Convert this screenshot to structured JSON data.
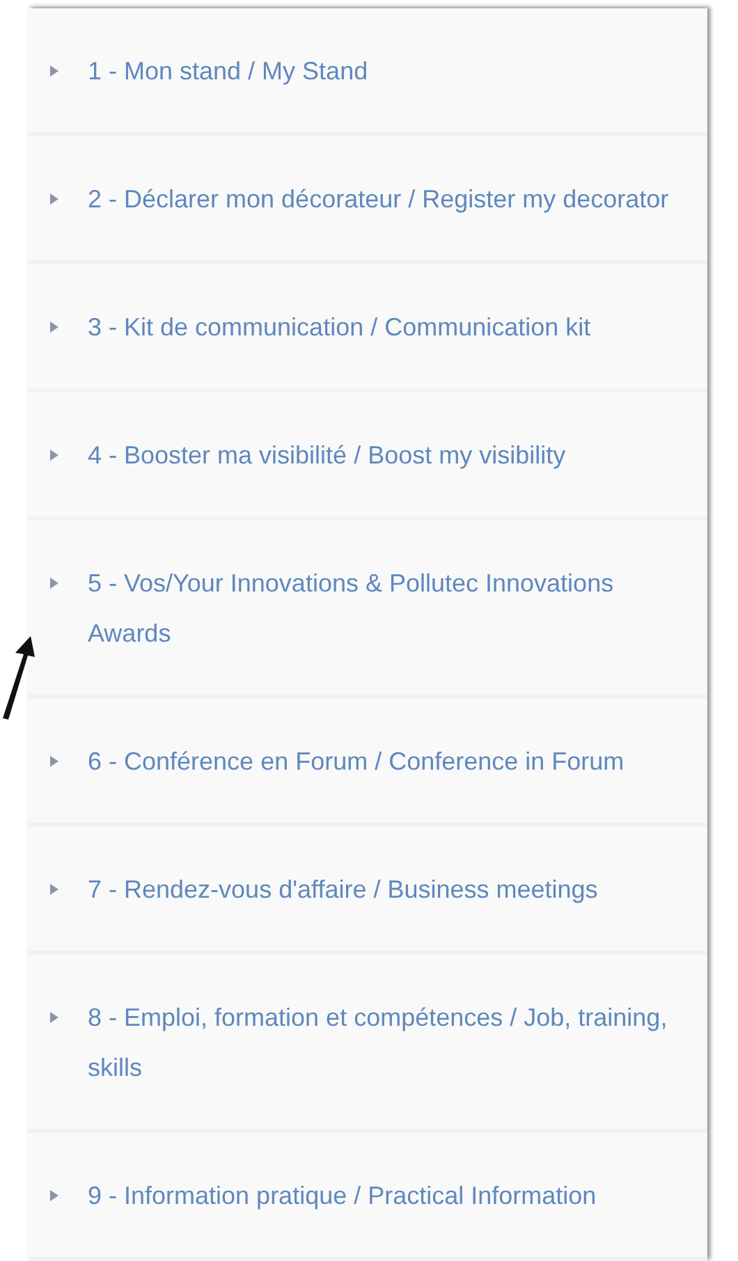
{
  "menu": {
    "items": [
      {
        "label": "1 - Mon stand / My Stand"
      },
      {
        "label": "2 - Déclarer mon décorateur / Register my decorator"
      },
      {
        "label": "3 - Kit de communication / Communication kit"
      },
      {
        "label": "4 - Booster ma visibilité / Boost my visibility"
      },
      {
        "label": "5 - Vos/Your Innovations & Pollutec Innovations Awards"
      },
      {
        "label": "6 - Conférence en Forum / Conference in Forum"
      },
      {
        "label": "7 - Rendez-vous d'affaire / Business meetings"
      },
      {
        "label": "8 - Emploi, formation et compétences / Job, training, skills"
      },
      {
        "label": "9 - Information pratique / Practical Information"
      }
    ]
  }
}
